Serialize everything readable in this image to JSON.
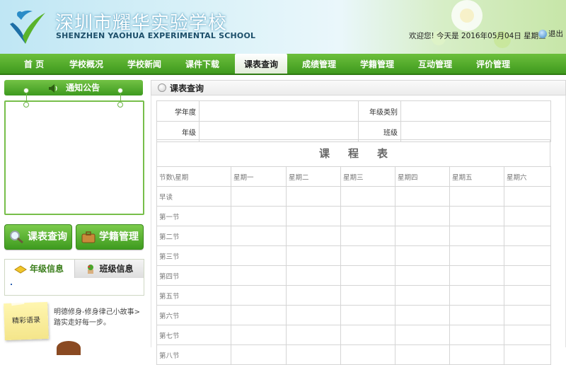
{
  "header": {
    "school_name_cn": "深圳市耀华实验学校",
    "school_name_en": "SHENZHEN YAOHUA EXPERIMENTAL SCHOOL",
    "welcome_text": "欢迎您!  今天是  2016年05月04日  星期三",
    "logout_label": "退出"
  },
  "nav": {
    "items": [
      {
        "label": "首 页"
      },
      {
        "label": "学校概况"
      },
      {
        "label": "学校新闻"
      },
      {
        "label": "课件下载"
      },
      {
        "label": "课表查询"
      },
      {
        "label": "成绩管理"
      },
      {
        "label": "学籍管理"
      },
      {
        "label": "互动管理"
      },
      {
        "label": "评价管理"
      }
    ],
    "active_index": 4
  },
  "sidebar": {
    "notice_title": "通知公告",
    "buttons": [
      {
        "label": "课表查询",
        "icon": "magnifier-icon"
      },
      {
        "label": "学籍管理",
        "icon": "briefcase-icon"
      }
    ],
    "tabs": [
      {
        "label": "年级信息",
        "icon": "notebook-icon"
      },
      {
        "label": "班级信息",
        "icon": "plant-icon"
      }
    ],
    "quote_label": "精彩语录",
    "quote_text": "明德修身-修身律己小故事>踏实走好每一步。"
  },
  "panel": {
    "title": "课表查询",
    "filter": {
      "year_label": "学年度",
      "grade_type_label": "年级类别",
      "grade_label": "年级",
      "class_label": "班级"
    },
    "schedule_title": "课程表",
    "columns": [
      "节数\\星期",
      "星期一",
      "星期二",
      "星期三",
      "星期四",
      "星期五",
      "星期六"
    ],
    "rows": [
      "早读",
      "第一节",
      "第二节",
      "第三节",
      "第四节",
      "第五节",
      "第六节",
      "第七节",
      "第八节"
    ]
  },
  "colors": {
    "nav_green": "#4aa526",
    "border_green": "#77be4a",
    "panel_border": "#d5d5d5"
  }
}
